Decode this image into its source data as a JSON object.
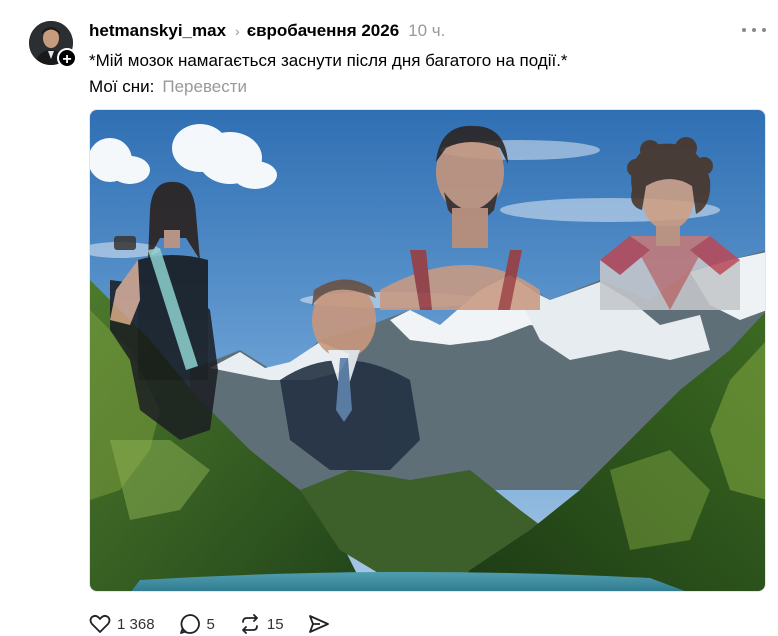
{
  "post": {
    "username": "hetmanskyi_max",
    "topic": "євробачення 2026",
    "time": "10 ч.",
    "line1": "*Мій мозок намагається заснути після дня багатого на події.*",
    "line2": "Мої сни:",
    "translate_label": "Перевести"
  },
  "actions": {
    "likes": "1 368",
    "comments": "5",
    "reposts": "15"
  },
  "icons": {
    "like": "heart-icon",
    "comment": "speech-bubble-icon",
    "repost": "repost-icon",
    "share": "paper-plane-icon",
    "more": "more-horizontal-icon",
    "follow": "plus-icon"
  },
  "colors": {
    "text": "#000000",
    "secondary": "#999999",
    "sky": "#3f7fc0",
    "forest": "#2f5a1e"
  }
}
